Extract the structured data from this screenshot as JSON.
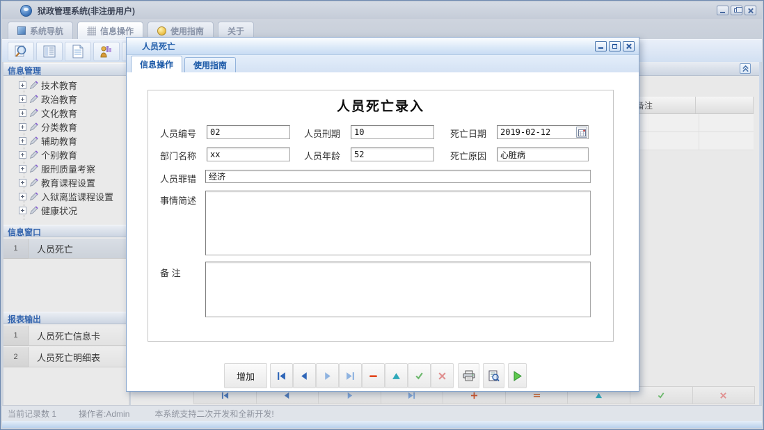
{
  "window": {
    "title": "狱政管理系统(非注册用户)"
  },
  "menu": {
    "tabs": [
      {
        "label": "系统导航"
      },
      {
        "label": "信息操作"
      },
      {
        "label": "使用指南"
      },
      {
        "label": "关于"
      }
    ]
  },
  "main_toolbar": {
    "icons": [
      "search-icon",
      "form-icon",
      "document-icon",
      "person-chart-icon",
      "monitor-icon"
    ]
  },
  "sidebar": {
    "info_header": "信息管理",
    "tree_items": [
      "技术教育",
      "政治教育",
      "文化教育",
      "分类教育",
      "辅助教育",
      "个别教育",
      "服刑质量考察",
      "教育课程设置",
      "入狱离监课程设置",
      "健康状况"
    ],
    "window_header": "信息窗口",
    "window_rows": [
      {
        "num": "1",
        "label": "人员死亡"
      }
    ],
    "report_header": "报表输出",
    "report_rows": [
      {
        "num": "1",
        "label": "人员死亡信息卡"
      },
      {
        "num": "2",
        "label": "人员死亡明细表"
      }
    ]
  },
  "background": {
    "table_columns": [
      "备注",
      ""
    ],
    "bottom_toolbar_icons": [
      "first-record-icon",
      "prev-record-icon",
      "next-record-icon",
      "last-record-icon",
      "add-record-icon",
      "delete-record-icon",
      "edit-record-icon",
      "confirm-icon",
      "cancel-icon"
    ]
  },
  "dialog": {
    "title": "人员死亡",
    "tabs": [
      {
        "label": "信息操作"
      },
      {
        "label": "使用指南"
      }
    ],
    "form": {
      "title": "人员死亡录入",
      "fields": {
        "person_id": {
          "label": "人员编号",
          "value": "02"
        },
        "sentence": {
          "label": "人员刑期",
          "value": "10"
        },
        "death_date": {
          "label": "死亡日期",
          "value": "2019-02-12"
        },
        "department": {
          "label": "部门名称",
          "value": "xx"
        },
        "age": {
          "label": "人员年龄",
          "value": "52"
        },
        "death_cause": {
          "label": "死亡原因",
          "value": "心脏病"
        },
        "crime": {
          "label": "人员罪错",
          "value": "经济"
        },
        "summary": {
          "label": "事情简述",
          "value": ""
        },
        "remark": {
          "label": "备 注",
          "value": ""
        }
      }
    },
    "toolbar": {
      "add_label": "增加",
      "icons": [
        "first-record-icon",
        "prev-record-icon",
        "next-record-icon",
        "last-record-icon",
        "delete-record-icon",
        "edit-record-icon",
        "confirm-icon",
        "cancel-icon",
        "print-icon",
        "print-preview-icon",
        "run-icon"
      ]
    }
  },
  "status_bar": {
    "record_count": "当前记录数 1",
    "operator": "操作者:Admin",
    "message": "本系统支持二次开发和全新开发!"
  },
  "colors": {
    "accent_blue": "#1c5aa8",
    "nav_blue": "#2f66b8",
    "nav_blue_light": "#8fb3e0",
    "delete_red": "#e2471f",
    "edit_teal": "#2fa9ba",
    "confirm_green": "#6cb86c",
    "cancel_red": "#e09090",
    "run_green": "#5ec84e"
  }
}
